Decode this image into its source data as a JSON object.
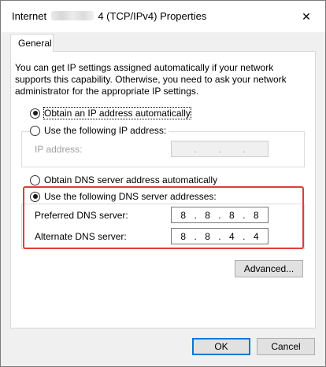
{
  "window": {
    "title_prefix": "Internet",
    "title_suffix": "4 (TCP/IPv4) Properties",
    "close_glyph": "✕"
  },
  "tabs": [
    {
      "label": "General",
      "active": true
    }
  ],
  "description": "You can get IP settings assigned automatically if your network supports this capability. Otherwise, you need to ask your network administrator for the appropriate IP settings.",
  "ip_options": {
    "auto_label": "Obtain an IP address automatically",
    "manual_label": "Use the following IP address:",
    "selected": "auto"
  },
  "ip_address": {
    "label": "IP address:",
    "octets": [
      "",
      "",
      "",
      ""
    ],
    "separator": "."
  },
  "dns_options": {
    "auto_label": "Obtain DNS server address automatically",
    "manual_label": "Use the following DNS server addresses:",
    "selected": "manual"
  },
  "preferred_dns": {
    "label": "Preferred DNS server:",
    "octets": [
      "8",
      "8",
      "8",
      "8"
    ],
    "separator": "."
  },
  "alternate_dns": {
    "label": "Alternate DNS server:",
    "octets": [
      "8",
      "8",
      "4",
      "4"
    ],
    "separator": "."
  },
  "buttons": {
    "advanced": "Advanced...",
    "ok": "OK",
    "cancel": "Cancel"
  },
  "colors": {
    "highlight": "#e23b3b",
    "default_button_border": "#0078d7"
  }
}
